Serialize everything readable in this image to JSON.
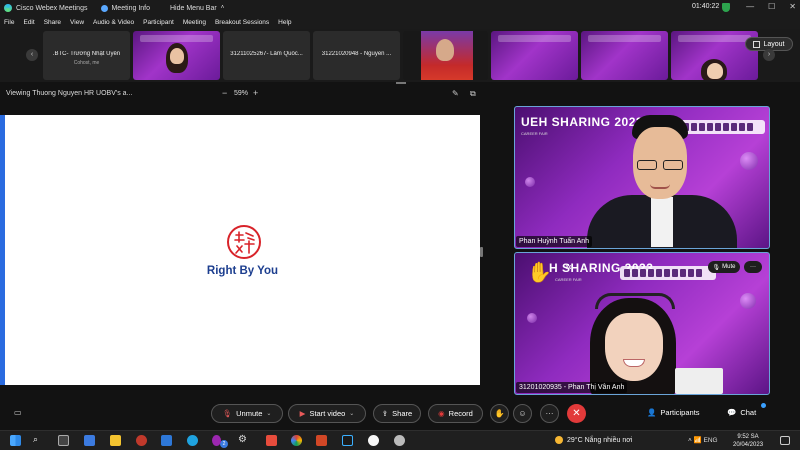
{
  "window": {
    "app_title": "Cisco Webex Meetings",
    "meeting_info": "Meeting Info",
    "hide_menu_bar": "Hide Menu Bar",
    "timer": "01:40:22"
  },
  "menu": [
    "File",
    "Edit",
    "Share",
    "View",
    "Audio & Video",
    "Participant",
    "Meeting",
    "Breakout Sessions",
    "Help"
  ],
  "thumbnails": [
    {
      "name": ".BTC- Trương Nhật Uyên",
      "sub": "Cohost, me",
      "kind": "name"
    },
    {
      "name": "",
      "sub": "",
      "kind": "video"
    },
    {
      "name": "31211025267- Lâm Quốc...",
      "sub": "",
      "kind": "name"
    },
    {
      "name": "31221020948 - Nguyễn ...",
      "sub": "",
      "kind": "name"
    },
    {
      "name": "",
      "sub": "",
      "kind": "video"
    },
    {
      "name": "",
      "sub": "",
      "kind": "video"
    },
    {
      "name": "",
      "sub": "",
      "kind": "video"
    },
    {
      "name": "",
      "sub": "",
      "kind": "video"
    }
  ],
  "layout_label": "Layout",
  "share_bar": {
    "viewing": "Viewing Thuong Nguyen HR UOBV's a...",
    "zoom": "59%",
    "zoom_minus": "−",
    "zoom_plus": "+"
  },
  "shared_content": {
    "brand_text": "Right By You"
  },
  "tiles": [
    {
      "headline": "UEH SHARING 2023",
      "sub": "CAREER FAIR",
      "label": "Phan Huỳnh Tuấn Anh"
    },
    {
      "headline": "H SHARING 2023",
      "sub": "CAREER FAIR",
      "label": "31201020935 - Phan Thị Vân Anh",
      "mute": "Mute",
      "more": "···"
    }
  ],
  "controls": {
    "unmute": "Unmute",
    "start_video": "Start video",
    "share": "Share",
    "record": "Record",
    "more": "···",
    "end": "✕",
    "participants": "Participants",
    "chat": "Chat"
  },
  "taskbar": {
    "weather": "29°C  Nắng nhiều nơi",
    "lang": "ENG",
    "time": "9:52 SA",
    "date": "20/04/2023",
    "badge_count": "2"
  },
  "colors": {
    "share_accent": "#2a6be0",
    "brand_blue": "#1c3e8f",
    "brand_red": "#d8232a",
    "end_red": "#e23a3a",
    "tile_border": "#6aa4d8"
  }
}
